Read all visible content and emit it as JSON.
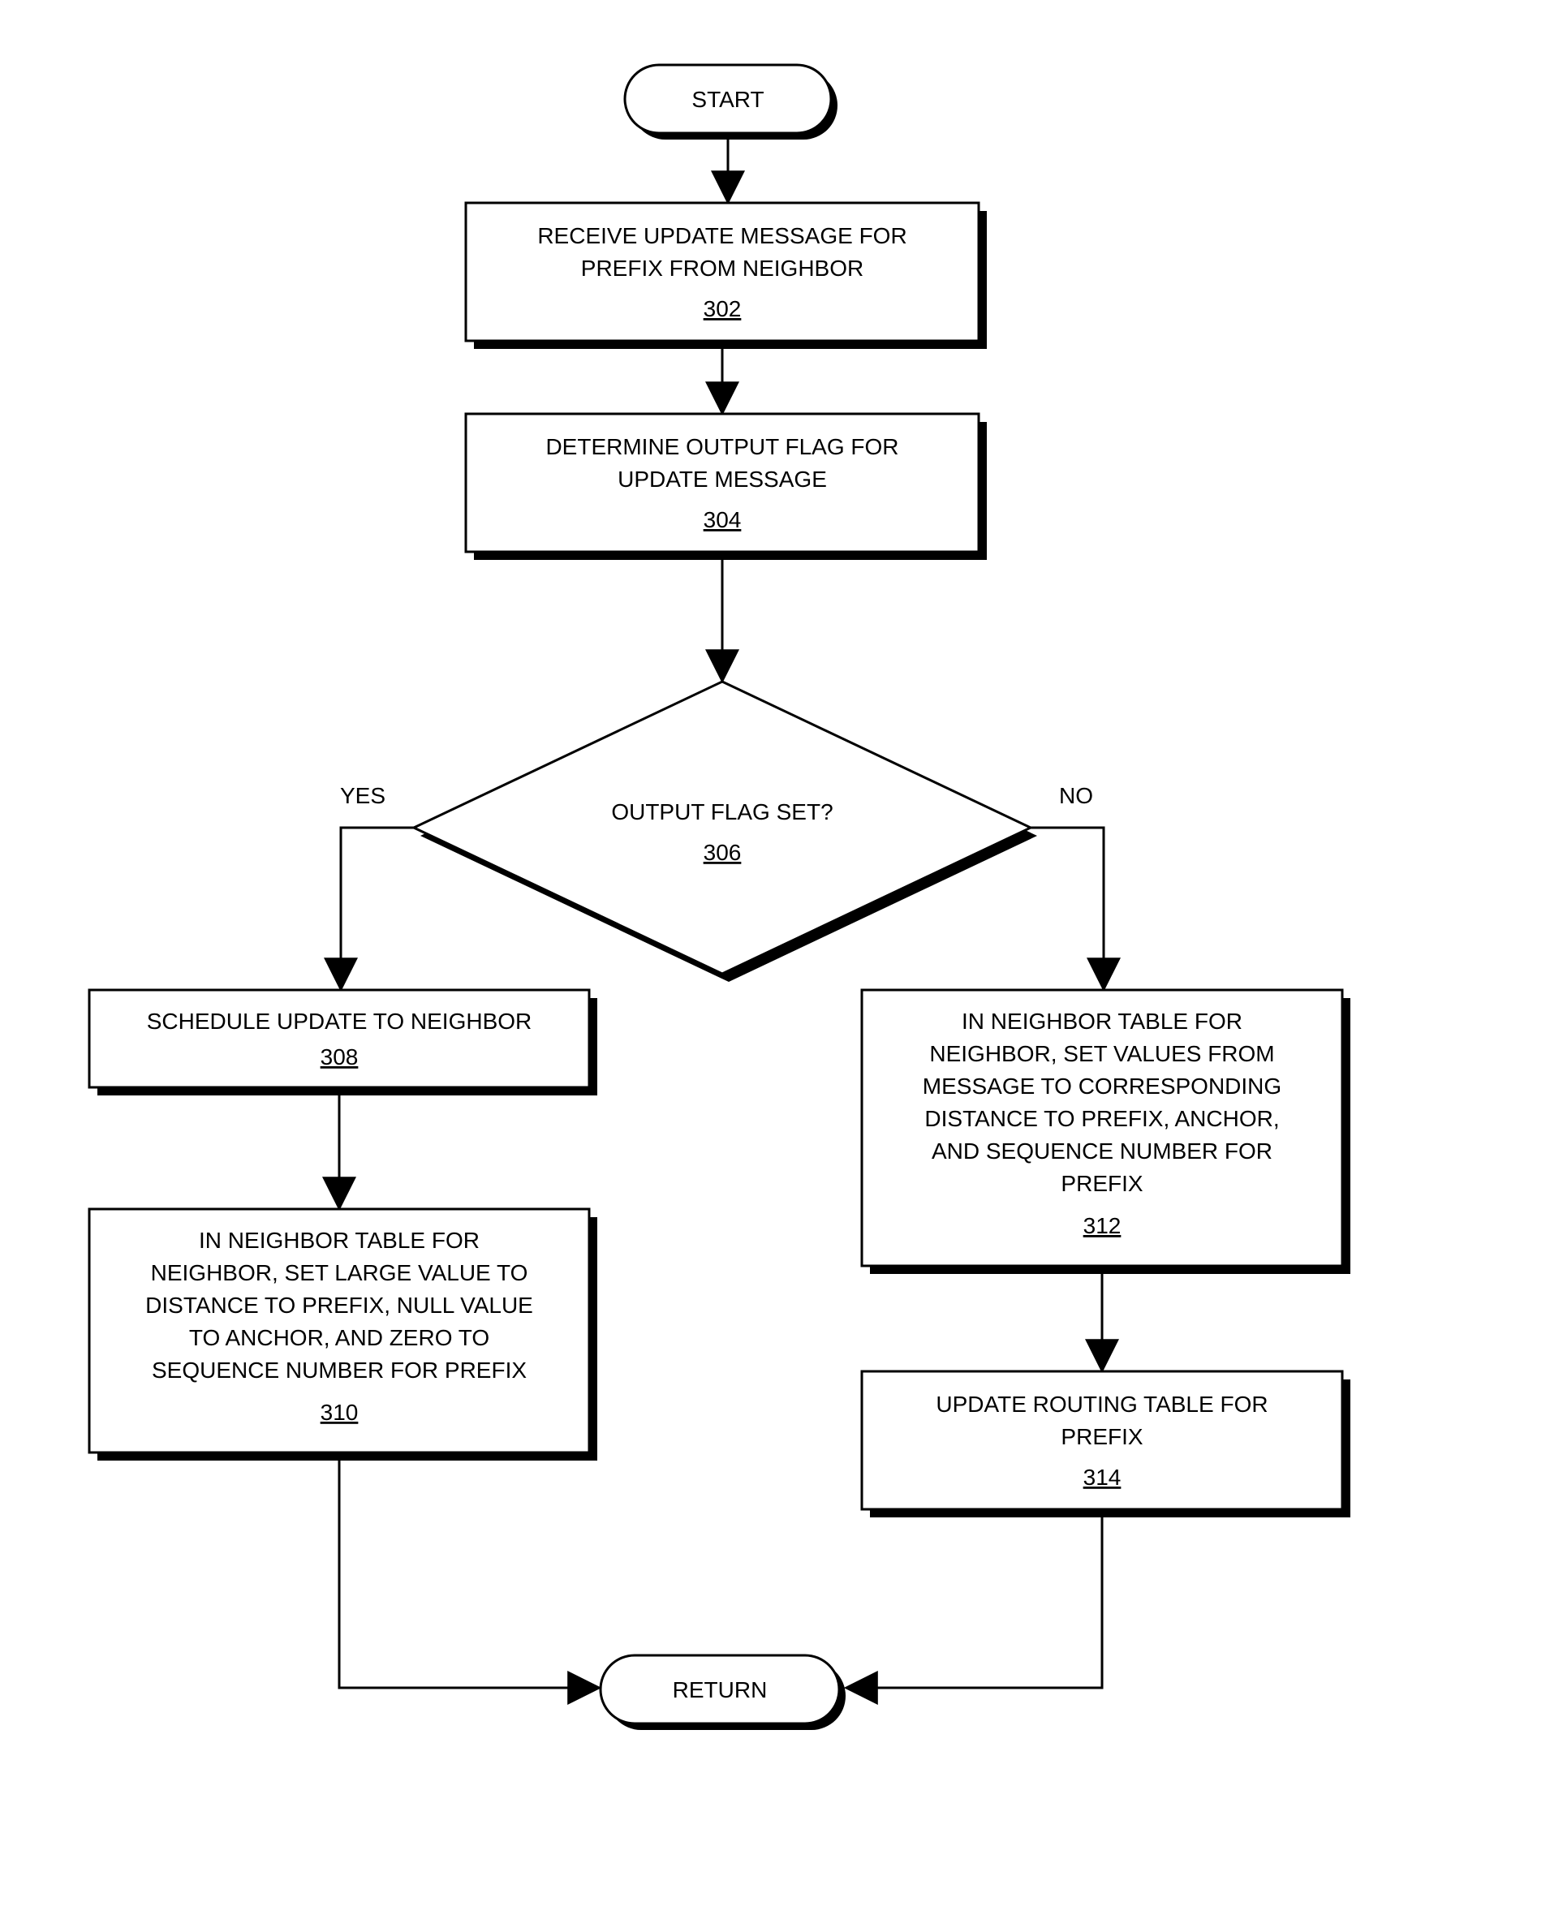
{
  "nodes": {
    "start": {
      "label": "START"
    },
    "return": {
      "label": "RETURN"
    },
    "n302": {
      "l1": "RECEIVE UPDATE MESSAGE FOR",
      "l2": "PREFIX FROM NEIGHBOR",
      "ref": "302"
    },
    "n304": {
      "l1": "DETERMINE OUTPUT FLAG FOR",
      "l2": "UPDATE MESSAGE",
      "ref": "304"
    },
    "n306": {
      "l1": "OUTPUT FLAG SET?",
      "ref": "306"
    },
    "n308": {
      "l1": "SCHEDULE UPDATE TO NEIGHBOR",
      "ref": "308"
    },
    "n310": {
      "l1": "IN NEIGHBOR TABLE FOR",
      "l2": "NEIGHBOR, SET LARGE VALUE TO",
      "l3": "DISTANCE TO PREFIX, NULL VALUE",
      "l4": "TO ANCHOR, AND ZERO TO",
      "l5": "SEQUENCE NUMBER FOR PREFIX",
      "ref": "310"
    },
    "n312": {
      "l1": "IN NEIGHBOR TABLE FOR",
      "l2": "NEIGHBOR, SET VALUES FROM",
      "l3": "MESSAGE TO CORRESPONDING",
      "l4": "DISTANCE TO PREFIX, ANCHOR,",
      "l5": "AND SEQUENCE NUMBER FOR",
      "l6": "PREFIX",
      "ref": "312"
    },
    "n314": {
      "l1": "UPDATE ROUTING TABLE FOR",
      "l2": "PREFIX",
      "ref": "314"
    }
  },
  "edges": {
    "yes": "YES",
    "no": "NO"
  },
  "chart_data": {
    "type": "flowchart",
    "nodes": [
      {
        "id": "start",
        "kind": "terminator",
        "label": "START"
      },
      {
        "id": "302",
        "kind": "process",
        "label": "RECEIVE UPDATE MESSAGE FOR PREFIX FROM NEIGHBOR"
      },
      {
        "id": "304",
        "kind": "process",
        "label": "DETERMINE OUTPUT FLAG FOR UPDATE MESSAGE"
      },
      {
        "id": "306",
        "kind": "decision",
        "label": "OUTPUT FLAG SET?"
      },
      {
        "id": "308",
        "kind": "process",
        "label": "SCHEDULE UPDATE TO NEIGHBOR"
      },
      {
        "id": "310",
        "kind": "process",
        "label": "IN NEIGHBOR TABLE FOR NEIGHBOR, SET LARGE VALUE TO DISTANCE TO PREFIX, NULL VALUE TO ANCHOR, AND ZERO TO SEQUENCE NUMBER FOR PREFIX"
      },
      {
        "id": "312",
        "kind": "process",
        "label": "IN NEIGHBOR TABLE FOR NEIGHBOR, SET VALUES FROM MESSAGE TO CORRESPONDING DISTANCE TO PREFIX, ANCHOR, AND SEQUENCE NUMBER FOR PREFIX"
      },
      {
        "id": "314",
        "kind": "process",
        "label": "UPDATE ROUTING TABLE FOR PREFIX"
      },
      {
        "id": "return",
        "kind": "terminator",
        "label": "RETURN"
      }
    ],
    "edges": [
      {
        "from": "start",
        "to": "302"
      },
      {
        "from": "302",
        "to": "304"
      },
      {
        "from": "304",
        "to": "306"
      },
      {
        "from": "306",
        "to": "308",
        "label": "YES"
      },
      {
        "from": "306",
        "to": "312",
        "label": "NO"
      },
      {
        "from": "308",
        "to": "310"
      },
      {
        "from": "312",
        "to": "314"
      },
      {
        "from": "310",
        "to": "return"
      },
      {
        "from": "314",
        "to": "return"
      }
    ]
  }
}
